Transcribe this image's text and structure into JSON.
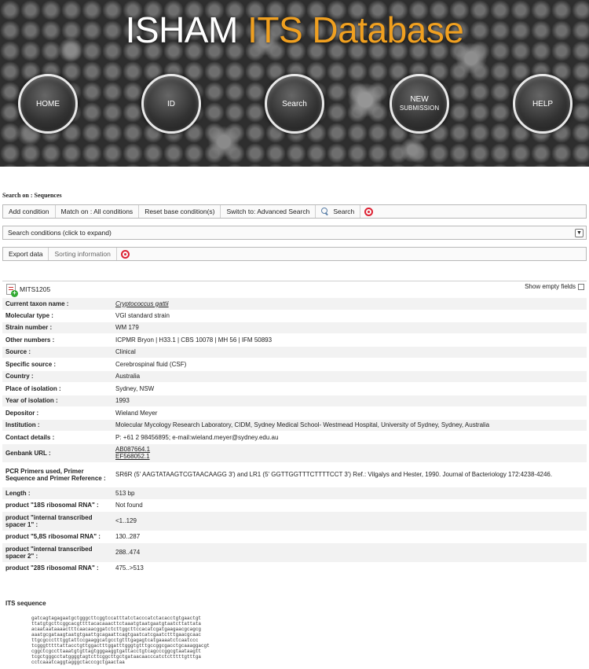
{
  "header": {
    "title_part1": "ISHAM",
    "title_part2": "ITS Database",
    "nav": [
      {
        "label": "HOME"
      },
      {
        "label": "ID"
      },
      {
        "label": "Search"
      },
      {
        "label_line1": "NEW",
        "label_line2": "SUBMISSION"
      },
      {
        "label": "HELP"
      }
    ]
  },
  "search": {
    "title": "Search on : Sequences",
    "toolbar": {
      "add_condition": "Add condition",
      "match_on": "Match on : All conditions",
      "reset_base": "Reset base condition(s)",
      "switch_advanced": "Switch to: Advanced Search",
      "search": "Search"
    },
    "conditions_label": "Search conditions (click to expand)",
    "export_label": "Export data",
    "sorting_label": "Sorting information"
  },
  "record": {
    "id": "MITS1205",
    "show_empty_fields": "Show empty fields",
    "fields": [
      {
        "label": "Current taxon name :",
        "value": "Cryptococcus gattii"
      },
      {
        "label": "Molecular type :",
        "value": "VGI standard strain"
      },
      {
        "label": "Strain number :",
        "value": "WM 179"
      },
      {
        "label": "Other numbers :",
        "value": "ICPMR Bryon | H33.1 | CBS 10078 | MH 56 | IFM 50893"
      },
      {
        "label": "Source :",
        "value": "Clinical"
      },
      {
        "label": "Specific source :",
        "value": "Cerebrospinal fluid (CSF)"
      },
      {
        "label": "Country :",
        "value": "Australia"
      },
      {
        "label": "Place of isolation :",
        "value": "Sydney, NSW"
      },
      {
        "label": "Year of isolation :",
        "value": "1993"
      },
      {
        "label": "Depositor :",
        "value": "Wieland Meyer"
      },
      {
        "label": "Institution :",
        "value": "Molecular Mycology Research Laboratory, CIDM, Sydney Medical School- Westmead Hospital, University of Sydney, Sydney, Australia"
      },
      {
        "label": "Contact details :",
        "value": "P: +61 2 98456895; e-mail:wieland.meyer@sydney.edu.au"
      },
      {
        "label": "Genbank URL :",
        "value1": "AB087664.1",
        "value2": "EF568052.1"
      },
      {
        "label": "PCR Primers used, Primer Sequence and Primer Reference :",
        "value": "SR6R (5' AAGTATAAGTCGTAACAAGG 3') and LR1 (5' GGTTGGTTTCTTTTCCT 3') Ref.: Vilgalys and Hester, 1990. Journal of Bacteriology 172:4238-4246."
      },
      {
        "label": "Length :",
        "value": "513 bp"
      },
      {
        "label": "product \"18S ribosomal RNA\" :",
        "value": "Not found"
      },
      {
        "label": "product \"internal transcribed spacer 1\" :",
        "value": "<1..129"
      },
      {
        "label": "product \"5,8S ribosomal RNA\" :",
        "value": "130..287"
      },
      {
        "label": "product \"internal transcribed spacer 2\" :",
        "value": "288..474"
      },
      {
        "label": "product \"28S ribosomal RNA\" :",
        "value": "475..>513"
      }
    ],
    "its_title": "ITS sequence",
    "its_sequence": "gatcagtagagaatgctgggcttcggtccatttatctacccatctacacctgtgaactgt\nttatgtgcttcggcacgttttacacaaacttctaaatgtaatgaatgtaatcttattata\nacaataataaaactttcaacaacggatctcttggcttccacatcgatgaagaacgcagcg\naaatgcgataagtaatgtgaattgcagaattcagtgaatcatcgaatctttgaacgcaac\nttgcgccctttggtattccgaaggcatgcctgtttgagagtcatgaaaatctcaatccc\ntcgggtttttattacctgttggactttggatttgggtgtttgccggcgacctgcaaaggacgt\ncggctcgccttaaatgtgttagtgggaaggtgattacctgtcagcccggcgtaataagtt\ntcgctgggcctatggggtagtcttcggcttgctgataacaacccatctctttttgtttga\ncctcaaatcaggtagggctacccgctgaactaa"
  }
}
